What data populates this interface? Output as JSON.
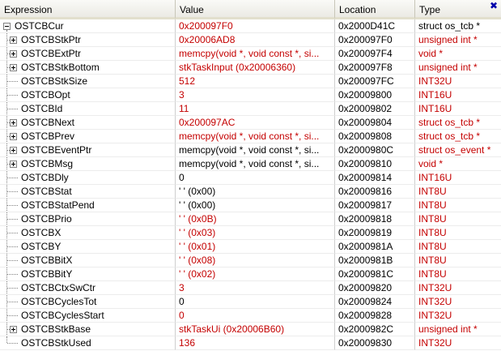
{
  "header": {
    "expression": "Expression",
    "value": "Value",
    "location": "Location",
    "type": "Type",
    "close_glyph": "✖"
  },
  "rows": [
    {
      "expression": "OSTCBCur",
      "value": "0x200097F0",
      "location": "0x2000D41C",
      "type": "struct os_tcb *",
      "level": 0,
      "expander": "minus",
      "value_color": "red",
      "type_color": "black"
    },
    {
      "expression": "OSTCBStkPtr",
      "value": "0x20006AD8",
      "location": "0x200097F0",
      "type": "unsigned int *",
      "level": 1,
      "expander": "plus",
      "value_color": "red",
      "type_color": "red"
    },
    {
      "expression": "OSTCBExtPtr",
      "value": "memcpy(void *, void const *, si...",
      "location": "0x200097F4",
      "type": "void *",
      "level": 1,
      "expander": "plus",
      "value_color": "red",
      "type_color": "red"
    },
    {
      "expression": "OSTCBStkBottom",
      "value": "stkTaskInput (0x20006360)",
      "location": "0x200097F8",
      "type": "unsigned int *",
      "level": 1,
      "expander": "plus",
      "value_color": "red",
      "type_color": "red"
    },
    {
      "expression": "OSTCBStkSize",
      "value": "512",
      "location": "0x200097FC",
      "type": "INT32U",
      "level": 1,
      "expander": "none",
      "value_color": "red",
      "type_color": "red"
    },
    {
      "expression": "OSTCBOpt",
      "value": "3",
      "location": "0x20009800",
      "type": "INT16U",
      "level": 1,
      "expander": "none",
      "value_color": "red",
      "type_color": "red"
    },
    {
      "expression": "OSTCBId",
      "value": "11",
      "location": "0x20009802",
      "type": "INT16U",
      "level": 1,
      "expander": "none",
      "value_color": "red",
      "type_color": "red"
    },
    {
      "expression": "OSTCBNext",
      "value": "0x200097AC",
      "location": "0x20009804",
      "type": "struct os_tcb *",
      "level": 1,
      "expander": "plus",
      "value_color": "red",
      "type_color": "red"
    },
    {
      "expression": "OSTCBPrev",
      "value": "memcpy(void *, void const *, si...",
      "location": "0x20009808",
      "type": "struct os_tcb *",
      "level": 1,
      "expander": "plus",
      "value_color": "red",
      "type_color": "red"
    },
    {
      "expression": "OSTCBEventPtr",
      "value": "memcpy(void *, void const *, si...",
      "location": "0x2000980C",
      "type": "struct os_event *",
      "level": 1,
      "expander": "plus",
      "value_color": "black",
      "type_color": "red"
    },
    {
      "expression": "OSTCBMsg",
      "value": "memcpy(void *, void const *, si...",
      "location": "0x20009810",
      "type": "void *",
      "level": 1,
      "expander": "plus",
      "value_color": "black",
      "type_color": "red"
    },
    {
      "expression": "OSTCBDly",
      "value": "0",
      "location": "0x20009814",
      "type": "INT16U",
      "level": 1,
      "expander": "none",
      "value_color": "black",
      "type_color": "red"
    },
    {
      "expression": "OSTCBStat",
      "value": "' ' (0x00)",
      "location": "0x20009816",
      "type": "INT8U",
      "level": 1,
      "expander": "none",
      "value_color": "black",
      "type_color": "red"
    },
    {
      "expression": "OSTCBStatPend",
      "value": "' ' (0x00)",
      "location": "0x20009817",
      "type": "INT8U",
      "level": 1,
      "expander": "none",
      "value_color": "black",
      "type_color": "red"
    },
    {
      "expression": "OSTCBPrio",
      "value": "' ' (0x0B)",
      "location": "0x20009818",
      "type": "INT8U",
      "level": 1,
      "expander": "none",
      "value_color": "red",
      "type_color": "red"
    },
    {
      "expression": "OSTCBX",
      "value": "' ' (0x03)",
      "location": "0x20009819",
      "type": "INT8U",
      "level": 1,
      "expander": "none",
      "value_color": "red",
      "type_color": "red"
    },
    {
      "expression": "OSTCBY",
      "value": "' ' (0x01)",
      "location": "0x2000981A",
      "type": "INT8U",
      "level": 1,
      "expander": "none",
      "value_color": "red",
      "type_color": "red"
    },
    {
      "expression": "OSTCBBitX",
      "value": "' ' (0x08)",
      "location": "0x2000981B",
      "type": "INT8U",
      "level": 1,
      "expander": "none",
      "value_color": "red",
      "type_color": "red"
    },
    {
      "expression": "OSTCBBitY",
      "value": "' ' (0x02)",
      "location": "0x2000981C",
      "type": "INT8U",
      "level": 1,
      "expander": "none",
      "value_color": "red",
      "type_color": "red"
    },
    {
      "expression": "OSTCBCtxSwCtr",
      "value": "3",
      "location": "0x20009820",
      "type": "INT32U",
      "level": 1,
      "expander": "none",
      "value_color": "red",
      "type_color": "red"
    },
    {
      "expression": "OSTCBCyclesTot",
      "value": "0",
      "location": "0x20009824",
      "type": "INT32U",
      "level": 1,
      "expander": "none",
      "value_color": "black",
      "type_color": "red"
    },
    {
      "expression": "OSTCBCyclesStart",
      "value": "0",
      "location": "0x20009828",
      "type": "INT32U",
      "level": 1,
      "expander": "none",
      "value_color": "red",
      "type_color": "red"
    },
    {
      "expression": "OSTCBStkBase",
      "value": "stkTaskUi (0x20006B60)",
      "location": "0x2000982C",
      "type": "unsigned int *",
      "level": 1,
      "expander": "plus",
      "value_color": "red",
      "type_color": "red"
    },
    {
      "expression": "OSTCBStkUsed",
      "value": "136",
      "location": "0x20009830",
      "type": "INT32U",
      "level": 1,
      "expander": "none",
      "value_color": "red",
      "type_color": "red"
    }
  ]
}
